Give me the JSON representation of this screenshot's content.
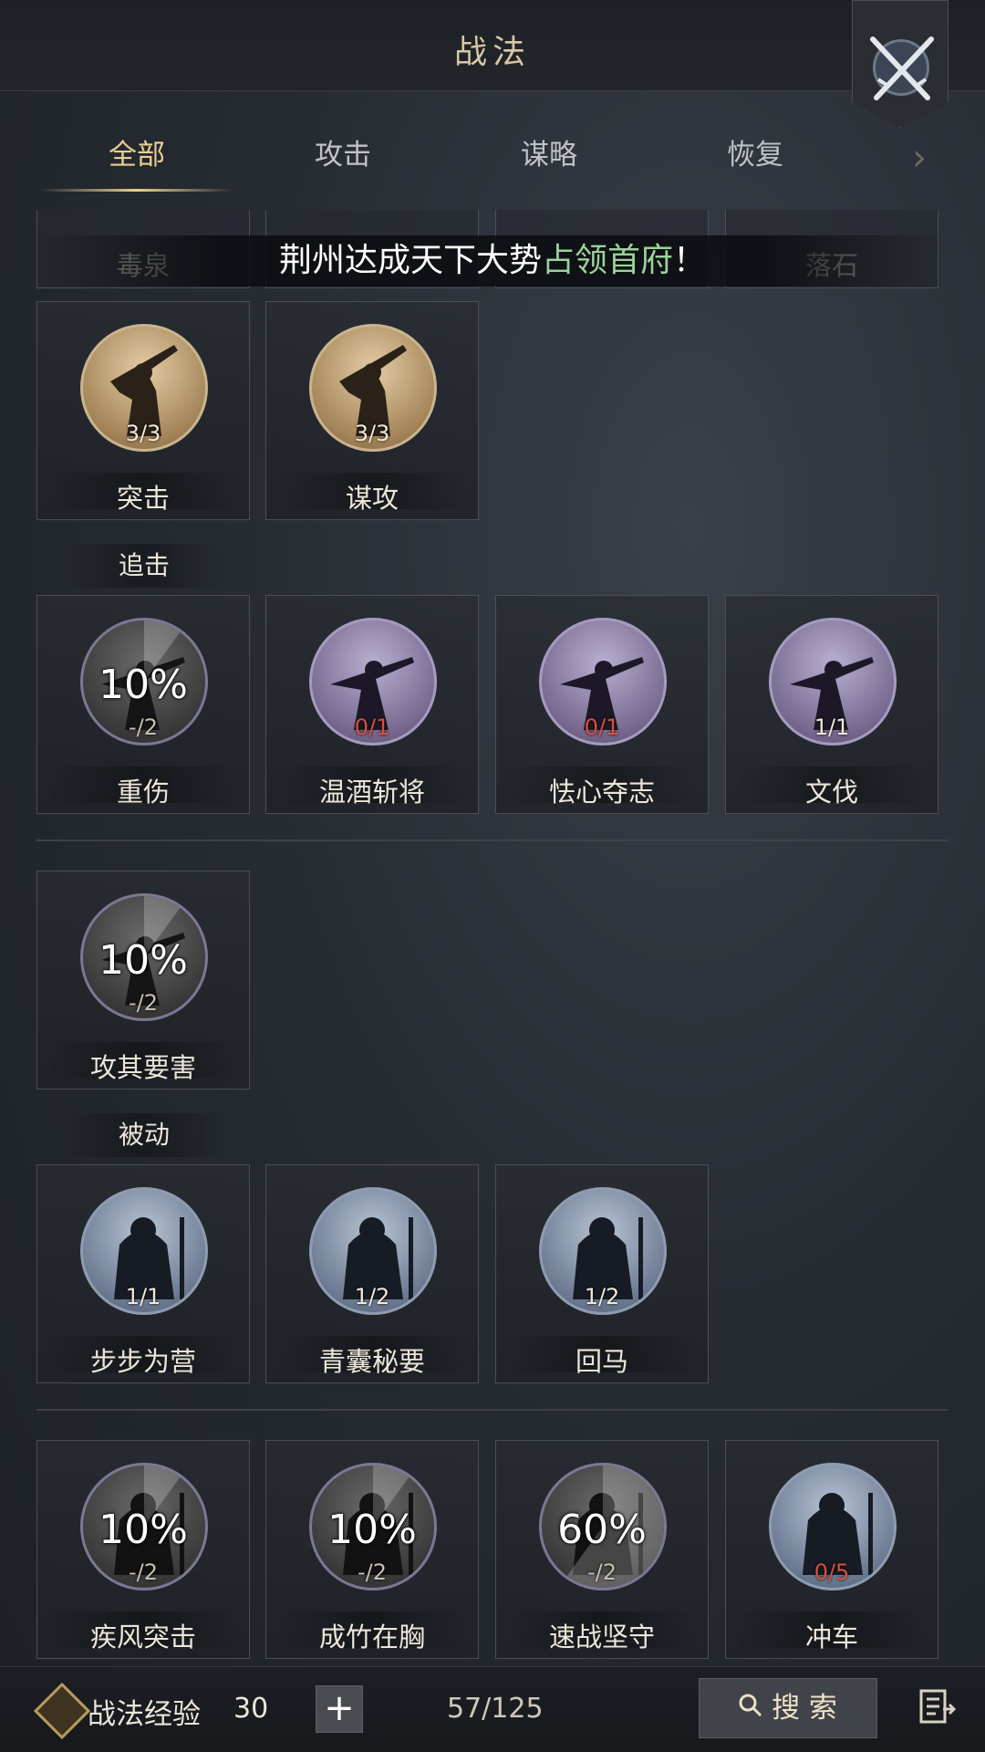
{
  "header": {
    "title": "战法"
  },
  "tabs": [
    {
      "label": "全部",
      "active": true
    },
    {
      "label": "攻击",
      "active": false
    },
    {
      "label": "谋略",
      "active": false
    },
    {
      "label": "恢复",
      "active": false
    }
  ],
  "clipped_row": [
    {
      "name": "毒泉"
    },
    {
      "name": ""
    },
    {
      "name": ""
    },
    {
      "name": "落石"
    }
  ],
  "banner": {
    "text_main": "荆州达成天下大势",
    "text_highlight": "占领首府",
    "text_end": "！"
  },
  "group1": [
    {
      "name": "突击",
      "count": "3/3",
      "style": "gold"
    },
    {
      "name": "谋攻",
      "count": "3/3",
      "style": "gold"
    }
  ],
  "section_chase": {
    "label": "追击"
  },
  "group2": [
    {
      "name": "重伤",
      "count": "-/2",
      "percent": "10%",
      "style": "gray"
    },
    {
      "name": "温酒斩将",
      "count": "0/1",
      "style": "purple"
    },
    {
      "name": "怯心夺志",
      "count": "0/1",
      "style": "purple"
    },
    {
      "name": "文伐",
      "count": "1/1",
      "style": "purple"
    }
  ],
  "group3": [
    {
      "name": "攻其要害",
      "count": "-/2",
      "percent": "10%",
      "style": "gray"
    }
  ],
  "section_passive": {
    "label": "被动"
  },
  "group4": [
    {
      "name": "步步为营",
      "count": "1/1",
      "style": "blue"
    },
    {
      "name": "青囊秘要",
      "count": "1/2",
      "style": "blue"
    },
    {
      "name": "回马",
      "count": "1/2",
      "style": "blue"
    }
  ],
  "group5": [
    {
      "name": "疾风突击",
      "count": "-/2",
      "percent": "10%",
      "style": "gray"
    },
    {
      "name": "成竹在胸",
      "count": "-/2",
      "percent": "10%",
      "style": "gray"
    },
    {
      "name": "速战坚守",
      "count": "-/2",
      "percent": "60%",
      "style": "gray"
    },
    {
      "name": "冲车",
      "count": "0/5",
      "style": "blue"
    }
  ],
  "bottom": {
    "exp_label": "战法经验",
    "exp_value": "30",
    "plus": "+",
    "progress": "57/125",
    "search_label": "搜 索"
  }
}
